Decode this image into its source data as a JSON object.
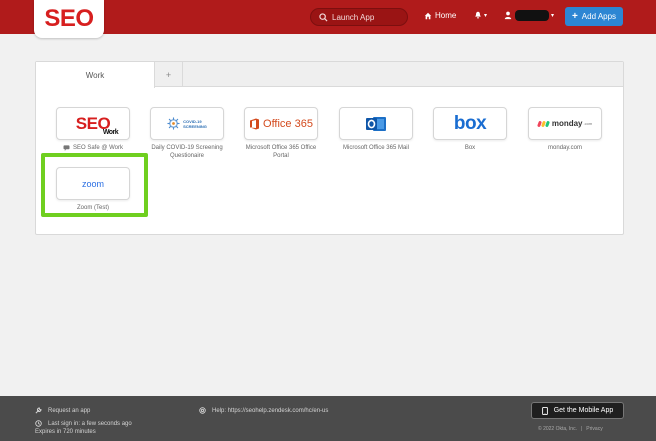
{
  "header": {
    "logo": "SEO",
    "search_placeholder": "Launch App",
    "home_label": "Home",
    "add_apps_label": "Add Apps"
  },
  "tabs": [
    {
      "label": "Work"
    },
    {
      "label": "+"
    }
  ],
  "apps": [
    {
      "name": "SEO Safe @ Work",
      "logo_main": "SEO",
      "logo_sub": "Work"
    },
    {
      "name": "Daily COVID-19 Screening Questionaire",
      "logo_line1": "COVID-19",
      "logo_line2": "SCREENING"
    },
    {
      "name": "Microsoft Office 365 Office Portal",
      "logo": "Office 365"
    },
    {
      "name": "Microsoft Office 365 Mail"
    },
    {
      "name": "Box",
      "logo": "box"
    },
    {
      "name": "monday.com",
      "logo": "monday",
      "logo_suffix": ".com"
    },
    {
      "name": "Zoom (Test)",
      "logo": "zoom"
    }
  ],
  "footer": {
    "request_app": "Request an app",
    "help": "Help: https://seohelp.zendesk.com/hc/en-us",
    "last_sign_in": "Last sign in: a few seconds ago",
    "expires": "Expires in 720 minutes",
    "mobile_app": "Get the Mobile App",
    "copyright": "© 2022 Okta, Inc.",
    "privacy": "Privacy"
  },
  "colors": {
    "header": "#b01b1b",
    "brand_red": "#d71f1f",
    "accent_blue": "#2d86d3",
    "highlight_green": "#6fcf1f",
    "footer": "#4b4b4b"
  }
}
